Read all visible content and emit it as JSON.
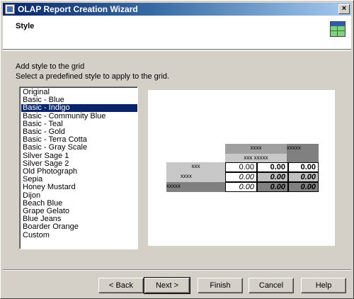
{
  "window": {
    "title": "OLAP Report Creation Wizard",
    "close_label": "×"
  },
  "header": {
    "title": "Style",
    "icon": "grid-style-icon"
  },
  "instructions": {
    "line1": "Add style to the grid",
    "line2": "Select a predefined style to apply to the grid."
  },
  "styles": {
    "selected": "Basic - Indigo",
    "items": [
      "Original",
      "Basic - Blue",
      "Basic - Indigo",
      "Basic - Community Blue",
      "Basic - Teal",
      "Basic - Gold",
      "Basic - Terra Cotta",
      "Basic - Gray Scale",
      "Silver Sage 1",
      "Silver Sage 2",
      "Old Photograph",
      "Sepia",
      "Honey Mustard",
      "Dijon",
      "Beach Blue",
      "Grape Gelato",
      "Blue Jeans",
      "Boarder Orange",
      "Custom"
    ]
  },
  "preview": {
    "col_header1": "xxxx",
    "col_header2": "xxxxx",
    "col_header3": "xxx xxxxx",
    "row_header1": "xxx",
    "row_header2": "xxxx",
    "row_header3": "xxxxx",
    "value": "0.00"
  },
  "buttons": {
    "back": "< Back",
    "next": "Next >",
    "finish": "Finish",
    "cancel": "Cancel",
    "help": "Help"
  },
  "colors": {
    "selection": "#0a246a",
    "face": "#d4d0c8"
  }
}
